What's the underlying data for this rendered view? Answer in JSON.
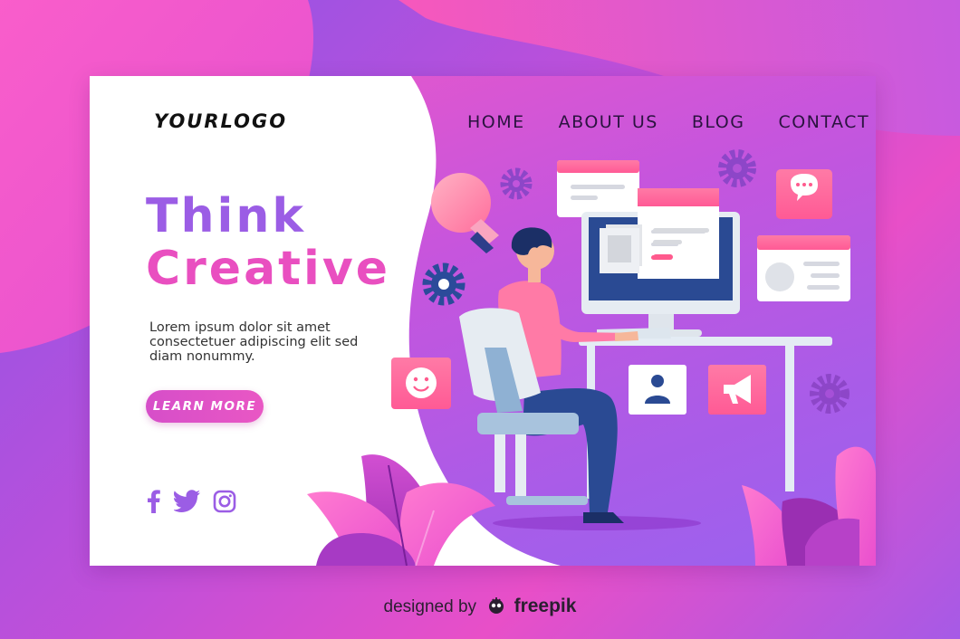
{
  "header": {
    "logo": "YOURLOGO",
    "nav": [
      "HOME",
      "ABOUT US",
      "BLOG",
      "CONTACT"
    ]
  },
  "hero": {
    "title_line1": "Think",
    "title_line2": "Creative",
    "body": "Lorem ipsum dolor sit amet consectetuer adipiscing elit sed diam nonummy.",
    "cta_label": "LEARN MORE"
  },
  "social": [
    "facebook-icon",
    "twitter-icon",
    "instagram-icon"
  ],
  "footer": {
    "prefix": "designed by",
    "brand": "freepik"
  },
  "colors": {
    "purple": "#9b5de5",
    "pink": "#e94fc0",
    "card_white": "#ffffff",
    "accent_pink": "#ff5a9c"
  }
}
